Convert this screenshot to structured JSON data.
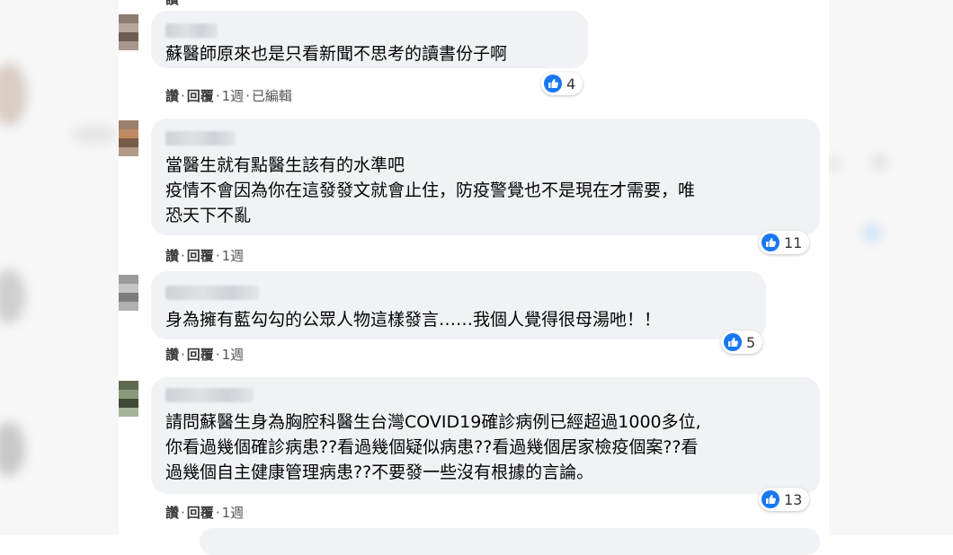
{
  "comments": [
    {
      "text": "蘇醫師原來也是只看新聞不思考的讀書份子啊",
      "actions": {
        "like": "讚",
        "reply": "回覆",
        "time": "1週",
        "edited": "已編輯"
      },
      "like_count": "4"
    },
    {
      "text": "當醫生就有點醫生該有的水準吧\n疫情不會因為你在這發發文就會止住，防疫警覺也不是現在才需要，唯\n恐天下不亂",
      "actions": {
        "like": "讚",
        "reply": "回覆",
        "time": "1週"
      },
      "like_count": "11"
    },
    {
      "text": "身為擁有藍勾勾的公眾人物這樣發言……我個人覺得很母湯吔！！",
      "actions": {
        "like": "讚",
        "reply": "回覆",
        "time": "1週"
      },
      "like_count": "5"
    },
    {
      "text": "請問蘇醫生身為胸腔科醫生台灣COVID19確診病例已經超過1000多位,\n你看過幾個確診病患??看過幾個疑似病患??看過幾個居家檢疫個案??看\n過幾個自主健康管理病患??不要發一些沒有根據的言論。",
      "actions": {
        "like": "讚",
        "reply": "回覆",
        "time": "1週"
      },
      "like_count": "13"
    }
  ],
  "colors": {
    "bubble": "#f0f2f5",
    "like_blue": "#1877f2",
    "text": "#050505"
  },
  "icons": {
    "like": "thumbs-up-icon"
  }
}
